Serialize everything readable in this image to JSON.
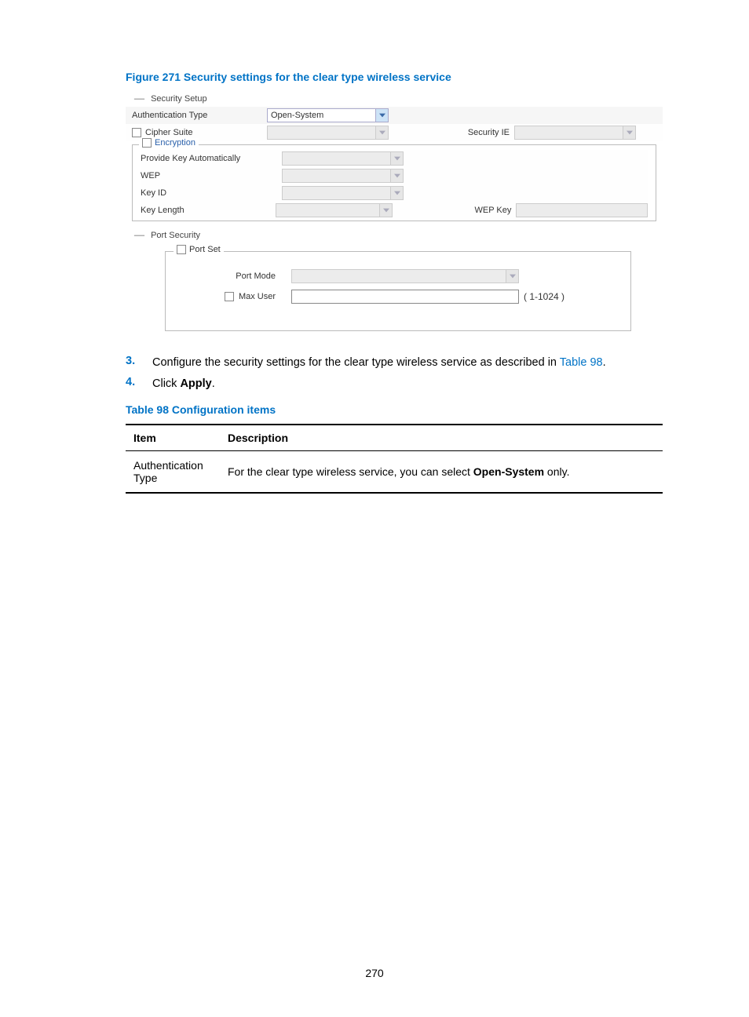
{
  "figure_caption": "Figure 271 Security settings for the clear type wireless service",
  "security_setup": {
    "header": "Security Setup",
    "auth_type_label": "Authentication Type",
    "auth_type_value": "Open-System",
    "cipher_suite_label": "Cipher Suite",
    "security_ie_label": "Security IE",
    "encryption": {
      "legend": "Encryption",
      "provide_key_label": "Provide Key Automatically",
      "wep_label": "WEP",
      "key_id_label": "Key ID",
      "key_length_label": "Key Length",
      "wep_key_label": "WEP Key"
    }
  },
  "port_security": {
    "header": "Port Security",
    "port_set_legend": "Port Set",
    "port_mode_label": "Port Mode",
    "max_user_label": "Max User",
    "max_user_range": "( 1-1024 )"
  },
  "steps": [
    {
      "num": "3.",
      "text_a": "Configure the security settings for the clear type wireless service as described in ",
      "link": "Table 98",
      "text_b": "."
    },
    {
      "num": "4.",
      "text_a": "Click ",
      "bold": "Apply",
      "text_b": "."
    }
  ],
  "table_caption": "Table 98 Configuration items",
  "table": {
    "th_item": "Item",
    "th_desc": "Description",
    "rows": [
      {
        "item": "Authentication Type",
        "desc_a": "For the clear type wireless service, you can select ",
        "desc_bold": "Open-System",
        "desc_b": " only."
      }
    ]
  },
  "page_number": "270"
}
